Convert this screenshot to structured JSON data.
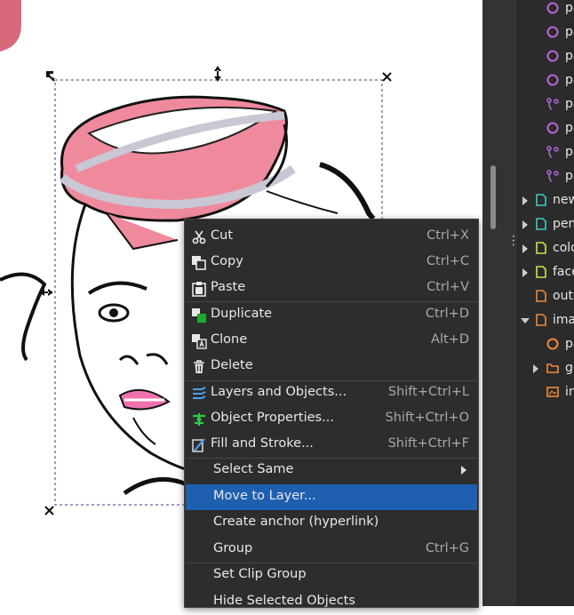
{
  "context_menu": {
    "items": [
      {
        "label": "Cut",
        "shortcut": "Ctrl+X",
        "icon": "scissors-icon"
      },
      {
        "label": "Copy",
        "shortcut": "Ctrl+C",
        "icon": "copy-icon"
      },
      {
        "label": "Paste",
        "shortcut": "Ctrl+V",
        "icon": "paste-icon"
      },
      {
        "label": "Duplicate",
        "shortcut": "Ctrl+D",
        "icon": "duplicate-icon"
      },
      {
        "label": "Clone",
        "shortcut": "Alt+D",
        "icon": "clone-icon"
      },
      {
        "label": "Delete",
        "shortcut": "",
        "icon": "trash-icon"
      },
      {
        "label": "Layers and Objects...",
        "shortcut": "Shift+Ctrl+L",
        "icon": "layers-icon"
      },
      {
        "label": "Object Properties...",
        "shortcut": "Shift+Ctrl+O",
        "icon": "object-properties-icon"
      },
      {
        "label": "Fill and Stroke...",
        "shortcut": "Shift+Ctrl+F",
        "icon": "fill-stroke-icon"
      },
      {
        "label": "Select Same",
        "shortcut": ""
      },
      {
        "label": "Move to Layer...",
        "shortcut": ""
      },
      {
        "label": "Create anchor (hyperlink)",
        "shortcut": ""
      },
      {
        "label": "Group",
        "shortcut": "Ctrl+G"
      },
      {
        "label": "Set Clip Group",
        "shortcut": ""
      },
      {
        "label": "Hide Selected Objects",
        "shortcut": ""
      }
    ],
    "highlighted": "Move to Layer...",
    "highlight_color": "#1f5fb0"
  },
  "objects_panel": {
    "rows": [
      {
        "label": "path",
        "icon": "circle-path-icon",
        "color": "#b565d9"
      },
      {
        "label": "path",
        "icon": "circle-path-icon",
        "color": "#b565d9"
      },
      {
        "label": "path",
        "icon": "circle-path-icon",
        "color": "#b565d9"
      },
      {
        "label": "path",
        "icon": "circle-path-icon",
        "color": "#b565d9"
      },
      {
        "label": "path",
        "icon": "bezier-path-icon",
        "color": "#b565d9"
      },
      {
        "label": "path",
        "icon": "circle-path-icon",
        "color": "#b565d9"
      },
      {
        "label": "path",
        "icon": "bezier-path-icon",
        "color": "#b565d9"
      },
      {
        "label": "path",
        "icon": "bezier-path-icon",
        "color": "#b565d9"
      },
      {
        "label": "new",
        "icon": "layer-icon",
        "color": "#3fc9c9"
      },
      {
        "label": "pen",
        "icon": "layer-icon",
        "color": "#3fc9c9"
      },
      {
        "label": "colo",
        "icon": "layer-icon",
        "color": "#d8e04a"
      },
      {
        "label": "face",
        "icon": "layer-icon",
        "color": "#d8e04a"
      },
      {
        "label": "outl",
        "icon": "layer-icon",
        "color": "#f08a3c"
      },
      {
        "label": "imag",
        "icon": "layer-icon",
        "color": "#f08a3c"
      },
      {
        "label": "path",
        "icon": "circle-path-icon",
        "color": "#f08a3c"
      },
      {
        "label": "g-",
        "icon": "folder-icon",
        "color": "#f08a3c"
      },
      {
        "label": "ima",
        "icon": "image-icon",
        "color": "#f08a3c"
      }
    ]
  }
}
